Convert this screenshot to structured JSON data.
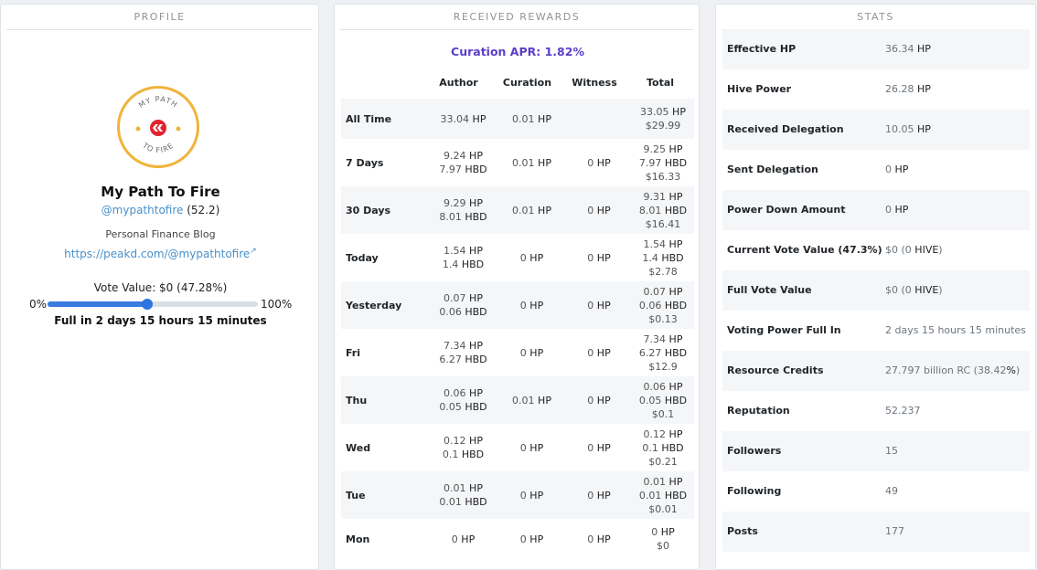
{
  "profile": {
    "title": "PROFILE",
    "logo_top": "MY PATH",
    "logo_bottom": "TO FIRE",
    "name": "My Path To Fire",
    "handle": "@mypathtofire",
    "reputation": "(52.2)",
    "about": "Personal Finance Blog",
    "link": "https://peakd.com/@mypathtofire",
    "vote_value": "Vote Value: $0 (47.28%)",
    "slider_min": "0%",
    "slider_max": "100%",
    "slider_value": 0.4728,
    "full_in": "Full in 2 days 15 hours 15 minutes"
  },
  "rewards": {
    "title": "RECEIVED REWARDS",
    "apr": "Curation APR: 1.82%",
    "headers": [
      "Author",
      "Curation",
      "Witness",
      "Total"
    ],
    "rows": [
      {
        "label": "All Time",
        "author": [
          [
            "33.04",
            "HP"
          ]
        ],
        "curation": [
          [
            "0.01",
            "HP"
          ]
        ],
        "witness": [],
        "total": [
          [
            "33.05",
            "HP"
          ],
          [
            "$29.99",
            ""
          ]
        ]
      },
      {
        "label": "7 Days",
        "author": [
          [
            "9.24",
            "HP"
          ],
          [
            "7.97",
            "HBD"
          ]
        ],
        "curation": [
          [
            "0.01",
            "HP"
          ]
        ],
        "witness": [
          [
            "0",
            "HP"
          ]
        ],
        "total": [
          [
            "9.25",
            "HP"
          ],
          [
            "7.97",
            "HBD"
          ],
          [
            "$16.33",
            ""
          ]
        ]
      },
      {
        "label": "30 Days",
        "author": [
          [
            "9.29",
            "HP"
          ],
          [
            "8.01",
            "HBD"
          ]
        ],
        "curation": [
          [
            "0.01",
            "HP"
          ]
        ],
        "witness": [
          [
            "0",
            "HP"
          ]
        ],
        "total": [
          [
            "9.31",
            "HP"
          ],
          [
            "8.01",
            "HBD"
          ],
          [
            "$16.41",
            ""
          ]
        ]
      },
      {
        "label": "Today",
        "author": [
          [
            "1.54",
            "HP"
          ],
          [
            "1.4",
            "HBD"
          ]
        ],
        "curation": [
          [
            "0",
            "HP"
          ]
        ],
        "witness": [
          [
            "0",
            "HP"
          ]
        ],
        "total": [
          [
            "1.54",
            "HP"
          ],
          [
            "1.4",
            "HBD"
          ],
          [
            "$2.78",
            ""
          ]
        ]
      },
      {
        "label": "Yesterday",
        "author": [
          [
            "0.07",
            "HP"
          ],
          [
            "0.06",
            "HBD"
          ]
        ],
        "curation": [
          [
            "0",
            "HP"
          ]
        ],
        "witness": [
          [
            "0",
            "HP"
          ]
        ],
        "total": [
          [
            "0.07",
            "HP"
          ],
          [
            "0.06",
            "HBD"
          ],
          [
            "$0.13",
            ""
          ]
        ]
      },
      {
        "label": "Fri",
        "author": [
          [
            "7.34",
            "HP"
          ],
          [
            "6.27",
            "HBD"
          ]
        ],
        "curation": [
          [
            "0",
            "HP"
          ]
        ],
        "witness": [
          [
            "0",
            "HP"
          ]
        ],
        "total": [
          [
            "7.34",
            "HP"
          ],
          [
            "6.27",
            "HBD"
          ],
          [
            "$12.9",
            ""
          ]
        ]
      },
      {
        "label": "Thu",
        "author": [
          [
            "0.06",
            "HP"
          ],
          [
            "0.05",
            "HBD"
          ]
        ],
        "curation": [
          [
            "0.01",
            "HP"
          ]
        ],
        "witness": [
          [
            "0",
            "HP"
          ]
        ],
        "total": [
          [
            "0.06",
            "HP"
          ],
          [
            "0.05",
            "HBD"
          ],
          [
            "$0.1",
            ""
          ]
        ]
      },
      {
        "label": "Wed",
        "author": [
          [
            "0.12",
            "HP"
          ],
          [
            "0.1",
            "HBD"
          ]
        ],
        "curation": [
          [
            "0",
            "HP"
          ]
        ],
        "witness": [
          [
            "0",
            "HP"
          ]
        ],
        "total": [
          [
            "0.12",
            "HP"
          ],
          [
            "0.1",
            "HBD"
          ],
          [
            "$0.21",
            ""
          ]
        ]
      },
      {
        "label": "Tue",
        "author": [
          [
            "0.01",
            "HP"
          ],
          [
            "0.01",
            "HBD"
          ]
        ],
        "curation": [
          [
            "0",
            "HP"
          ]
        ],
        "witness": [
          [
            "0",
            "HP"
          ]
        ],
        "total": [
          [
            "0.01",
            "HP"
          ],
          [
            "0.01",
            "HBD"
          ],
          [
            "$0.01",
            ""
          ]
        ]
      },
      {
        "label": "Mon",
        "author": [
          [
            "0",
            "HP"
          ]
        ],
        "curation": [
          [
            "0",
            "HP"
          ]
        ],
        "witness": [
          [
            "0",
            "HP"
          ]
        ],
        "total": [
          [
            "0",
            "HP"
          ],
          [
            "$0",
            ""
          ]
        ]
      }
    ]
  },
  "stats": {
    "title": "STATS",
    "rows": [
      {
        "label": "Effective HP",
        "value": "36.34",
        "unit": "HP"
      },
      {
        "label": "Hive Power",
        "value": "26.28",
        "unit": "HP"
      },
      {
        "label": "Received Delegation",
        "value": "10.05",
        "unit": "HP"
      },
      {
        "label": "Sent Delegation",
        "value": "0",
        "unit": "HP"
      },
      {
        "label": "Power Down Amount",
        "value": "0",
        "unit": "HP"
      },
      {
        "label": "Current Vote Value (47.3%)",
        "value": "$0 (0",
        "unit": "HIVE",
        "suffix": ")"
      },
      {
        "label": "Full Vote Value",
        "value": "$0 (0",
        "unit": "HIVE",
        "suffix": ")"
      },
      {
        "label": "Voting Power Full In",
        "value": "2 days 15 hours 15 minutes",
        "unit": ""
      },
      {
        "label": "Resource Credits",
        "value": "27.797 billion RC (38.42",
        "unit": "%",
        "suffix": ")"
      },
      {
        "label": "Reputation",
        "value": "52.237",
        "unit": ""
      },
      {
        "label": "Followers",
        "value": "15",
        "unit": ""
      },
      {
        "label": "Following",
        "value": "49",
        "unit": ""
      },
      {
        "label": "Posts",
        "value": "177",
        "unit": ""
      }
    ]
  },
  "colors": {
    "accent": "#5a3fc8",
    "link": "#4a90c8",
    "slider": "#3a7be0",
    "logo_ring": "#f0b43a",
    "logo_mark": "#e0232e"
  }
}
